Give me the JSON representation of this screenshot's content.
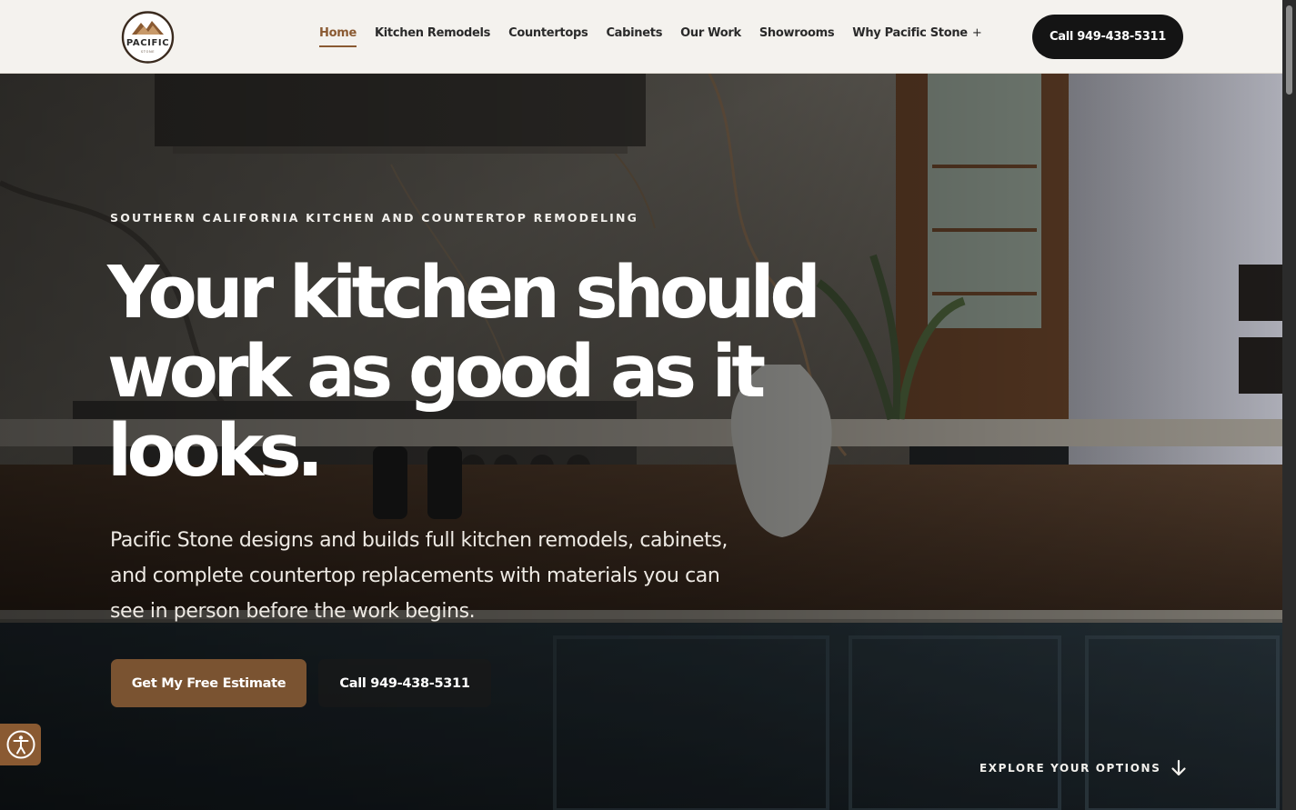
{
  "header": {
    "logo_text": "PACIFIC",
    "logo_subtext": "STONE",
    "nav": [
      {
        "label": "Home",
        "active": true
      },
      {
        "label": "Kitchen Remodels"
      },
      {
        "label": "Countertops"
      },
      {
        "label": "Cabinets"
      },
      {
        "label": "Our Work"
      },
      {
        "label": "Showrooms"
      },
      {
        "label": "Why Pacific Stone",
        "has_submenu": true,
        "submenu_icon": "plus-icon"
      }
    ],
    "plus_glyph": "+",
    "call_button": "Call 949-438-5311"
  },
  "hero": {
    "eyebrow": "SOUTHERN CALIFORNIA KITCHEN AND COUNTERTOP REMODELING",
    "headline": "Your kitchen should work as good as it looks.",
    "subtext": "Pacific Stone designs and builds full kitchen remodels, cabinets, and complete countertop replacements with materials you can see in person before the work begins.",
    "primary_button": "Get My Free Estimate",
    "secondary_button": "Call 949-438-5311",
    "explore_link": "EXPLORE YOUR OPTIONS",
    "explore_icon": "arrow-down-icon"
  },
  "accessibility": {
    "icon": "accessibility-icon"
  },
  "colors": {
    "header_bg": "#f4f2ee",
    "accent_brown": "#7a5331",
    "nav_active": "#8a5a32",
    "dark_button": "#141414"
  }
}
